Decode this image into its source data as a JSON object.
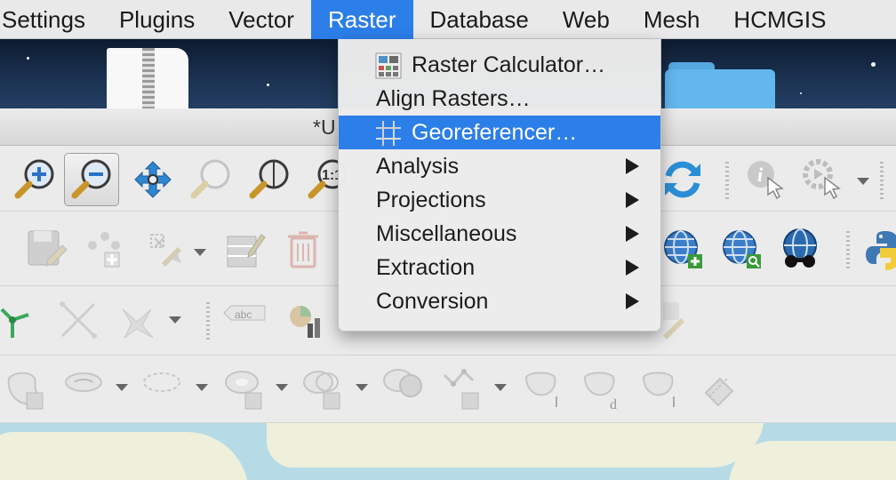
{
  "menubar": {
    "items": [
      "Settings",
      "Plugins",
      "Vector",
      "Raster",
      "Database",
      "Web",
      "Mesh",
      "HCMGIS"
    ],
    "active": "Raster"
  },
  "window": {
    "title": "*U"
  },
  "raster_menu": {
    "items": [
      {
        "label": "Raster Calculator…",
        "icon": "raster-calculator-icon"
      },
      {
        "label": "Align Rasters…"
      },
      {
        "label": "Georeferencer…",
        "icon": "georeferencer-icon",
        "selected": true
      },
      {
        "label": "Analysis",
        "submenu": true
      },
      {
        "label": "Projections",
        "submenu": true
      },
      {
        "label": "Miscellaneous",
        "submenu": true
      },
      {
        "label": "Extraction",
        "submenu": true
      },
      {
        "label": "Conversion",
        "submenu": true
      }
    ]
  },
  "toolbar": {
    "zoom_native_label": "1:1",
    "label_tool_text": "abc"
  },
  "colors": {
    "accent": "#2c7ee8",
    "menubar_bg": "#e9e9ea",
    "toolbar_bg": "#ebebeb",
    "map_water": "#b6dbe6",
    "map_land": "#eef0dc"
  }
}
